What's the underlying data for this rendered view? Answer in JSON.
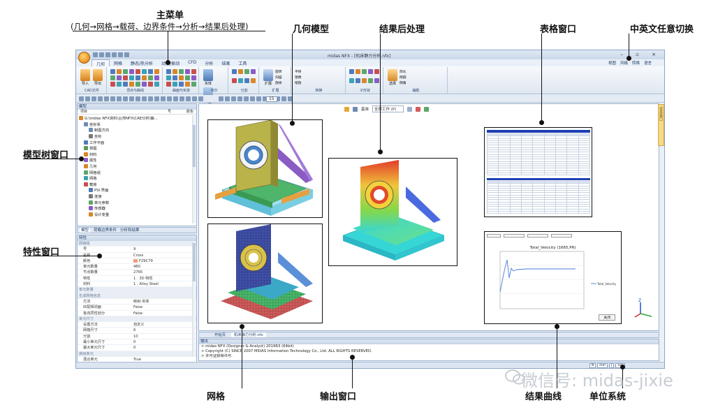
{
  "annotations": {
    "main_menu": "主菜单",
    "main_menu_sub": "(几何→网格→载荷、边界条件→分析→结果后处理)",
    "geometry_model": "几何模型",
    "post_processing": "结果后处理",
    "table_window": "表格窗口",
    "language_switch": "中英文任意切换",
    "model_tree_window": "模型树窗口",
    "property_window": "特性窗口",
    "mesh": "网格",
    "output_window": "输出窗口",
    "result_curve": "结果曲线",
    "unit_system": "单位系统"
  },
  "window": {
    "title": "midas NFX - [机床静力分析.nfx]",
    "controls": "– ▫ ×"
  },
  "ribbon": {
    "tabs": [
      "几何",
      "网格",
      "静态/热分析",
      "动态/振动",
      "CFD",
      "分析",
      "结果",
      "工具"
    ],
    "active_tab": "几何",
    "right_items": [
      "视图",
      "风格",
      "转换",
      "语言"
    ],
    "groups": [
      "CAD文件",
      "顶点与曲线",
      "曲面与实体",
      "布尔",
      "分割",
      "扩展",
      "转换",
      "子形状",
      "辅助"
    ],
    "labels": {
      "import": "导入",
      "export": "导出",
      "solid": "实体",
      "surface": "曲面",
      "extend": "扩展",
      "rotate": "旋转",
      "scan": "扫描",
      "loft": "放样",
      "select": "选择",
      "simplify": "简化",
      "fillet": "倒圆",
      "chamfer": "倒角",
      "move": "平移",
      "mirror": "镜像",
      "scale": "缩放"
    }
  },
  "toolbar": {
    "zoom_value": "15"
  },
  "tree_panel": {
    "title": "模型",
    "col_item": "项目",
    "col_id": "号",
    "col_color": "颜色",
    "items": [
      "G:\\midas NFX资料\\台湾NFX\\CAE分析\\静...",
      "坐标系",
      "制图方向",
      "坐标",
      "工作平面",
      "草图",
      "材料",
      "属性",
      "几何",
      "网格组",
      "网格",
      "载荷",
      "PSI 界面",
      "连接",
      "单元参数",
      "传感器",
      "设计变量"
    ]
  },
  "panel_tabs": [
    "模型",
    "荷载边界条件",
    "分析和结果"
  ],
  "property_panel": {
    "title": "特性",
    "rows": [
      {
        "k": "网格组",
        "v": "",
        "section": true
      },
      {
        "k": "号",
        "v": "9",
        "section": false
      },
      {
        "k": "名称",
        "v": "Cross",
        "section": false
      },
      {
        "k": "颜色",
        "v": "F29C79",
        "section": false
      },
      {
        "k": "单元数量",
        "v": "480",
        "section": false
      },
      {
        "k": "节点数量",
        "v": "2765",
        "section": false
      },
      {
        "k": "特性",
        "v": "1 : 3D 特性",
        "section": false
      },
      {
        "k": "材料",
        "v": "1 : Alloy Steel",
        "section": false
      },
      {
        "k": "单元数量",
        "v": "",
        "section": true
      },
      {
        "k": "生成网格信息",
        "v": "",
        "section": true
      },
      {
        "k": "方法",
        "v": "映射-实体",
        "section": false
      },
      {
        "k": "匹配相邻面",
        "v": "False",
        "section": false
      },
      {
        "k": "各向同性划分",
        "v": "False",
        "section": false
      },
      {
        "k": "单元尺寸",
        "v": "",
        "section": true
      },
      {
        "k": "设置方法",
        "v": "自定义",
        "section": false
      },
      {
        "k": "网格尺寸",
        "v": "6",
        "section": false
      },
      {
        "k": "分割",
        "v": "10",
        "section": false
      },
      {
        "k": "最小单元尺寸",
        "v": "0",
        "section": false
      },
      {
        "k": "最大单元尺寸",
        "v": "0",
        "section": false
      },
      {
        "k": "高级单元",
        "v": "",
        "section": true
      },
      {
        "k": "混合单元",
        "v": "True",
        "section": false
      }
    ],
    "apply": "适用"
  },
  "viewport": {
    "bar_items": [
      "基准",
      "全部工作 (P)"
    ],
    "right_strip": "任务窗口"
  },
  "doc_tabs": [
    "开始页",
    "机床静力分析.nfx"
  ],
  "output": {
    "title": "输出",
    "lines": [
      "> midas NFX (Designer & Analyst) 2019R3 (64bit)",
      "> Copyright (C) SINCE 2007 MIDAS Information Technology Co., Ltd. ALL RIGHTS RESERVED.",
      "> 许可证获得许可."
    ]
  },
  "chart_window": {
    "title": "Total_Velocity (1665,PR)",
    "legend": "Total_Velocity",
    "close_button": "关闭"
  },
  "statusbar": {
    "units": [
      "N",
      "mm",
      "J",
      "sec"
    ]
  },
  "watermark": "微信号: midas-jixie",
  "colors": {
    "ribbon_bg": "#dfe7f1",
    "titlebar": "#c9d8ea",
    "accent_orange": "#e07a10",
    "mesh_blue": "#3f4fa8",
    "mesh_green": "#47b86a",
    "mesh_red": "#d05a5a",
    "model_olive": "#b9b34a",
    "model_purple": "#8a5cc4",
    "contour_red": "#e23b2a",
    "contour_cyan": "#37d6d6"
  }
}
